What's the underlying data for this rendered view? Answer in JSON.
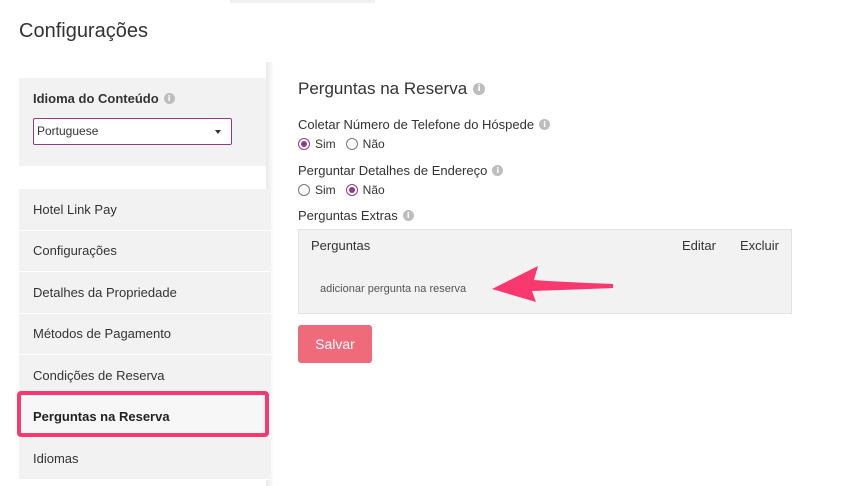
{
  "page": {
    "title": "Configurações"
  },
  "language": {
    "label": "Idioma do Conteúdo",
    "selected": "Portuguese"
  },
  "sidebar": {
    "items": [
      {
        "label": "Hotel Link Pay"
      },
      {
        "label": "Configurações"
      },
      {
        "label": "Detalhes da Propriedade"
      },
      {
        "label": "Métodos de Pagamento"
      },
      {
        "label": "Condições de Reserva"
      },
      {
        "label": "Perguntas na Reserva",
        "active": true
      },
      {
        "label": "Idiomas"
      }
    ]
  },
  "main": {
    "title": "Perguntas na Reserva",
    "phone": {
      "label": "Coletar Número de Telefone do Hóspede",
      "options": [
        "Sim",
        "Não"
      ],
      "selected": "Sim"
    },
    "address": {
      "label": "Perguntar Detalhes de Endereço",
      "options": [
        "Sim",
        "Não"
      ],
      "selected": "Não"
    },
    "extras": {
      "label": "Perguntas Extras",
      "columns": {
        "questions": "Perguntas",
        "edit": "Editar",
        "delete": "Excluir"
      },
      "add_link": "adicionar pergunta na reserva"
    },
    "save_label": "Salvar"
  },
  "annotations": {
    "highlight_color": "#f9386f",
    "accent_color": "#8e3b8a"
  },
  "icons": {
    "info": "info-icon",
    "caret": "caret-down-icon",
    "arrow": "pointer-arrow"
  }
}
